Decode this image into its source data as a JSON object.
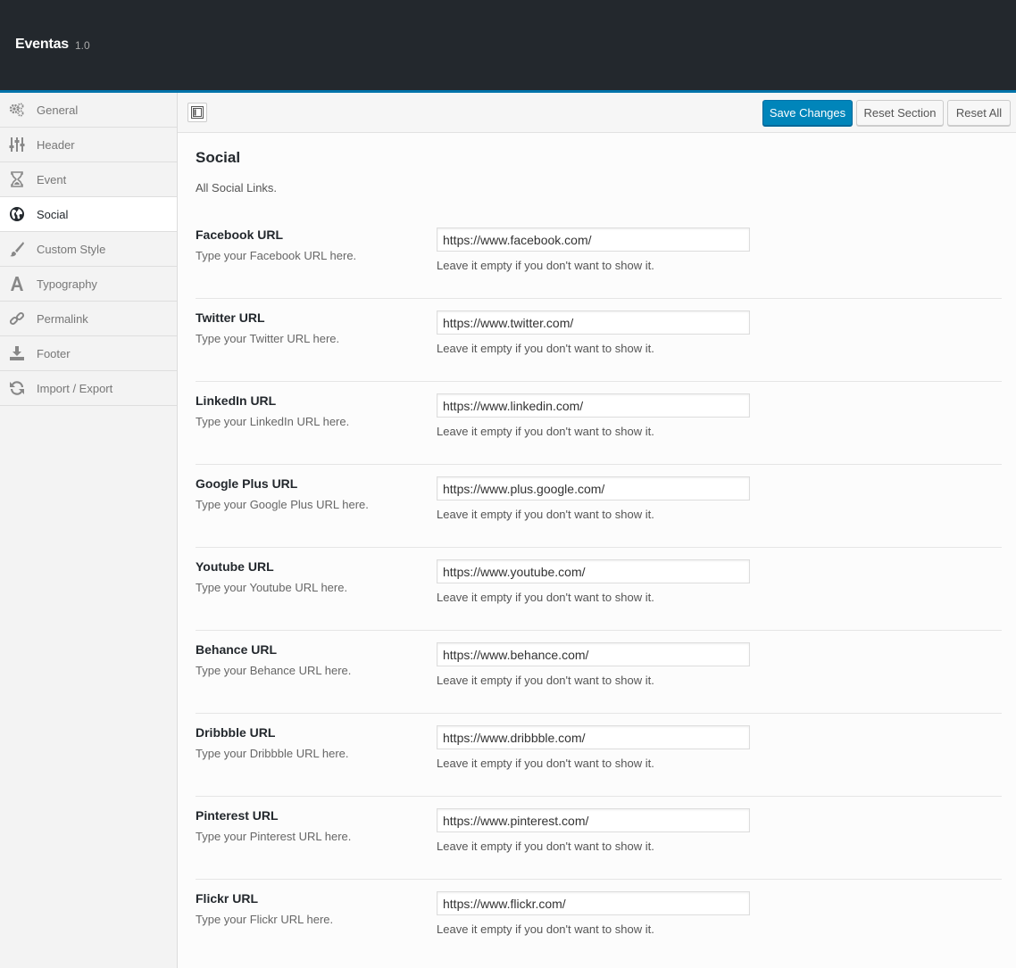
{
  "app": {
    "title": "Eventas",
    "version": "1.0"
  },
  "colors": {
    "header_bg": "#23282d",
    "accent": "#0073aa",
    "primary_button": "#0085ba"
  },
  "sidebar": {
    "items": [
      {
        "label": "General",
        "icon": "gears-icon",
        "active": false
      },
      {
        "label": "Header",
        "icon": "sliders-icon",
        "active": false
      },
      {
        "label": "Event",
        "icon": "hourglass-icon",
        "active": false
      },
      {
        "label": "Social",
        "icon": "globe-icon",
        "active": true
      },
      {
        "label": "Custom Style",
        "icon": "brush-icon",
        "active": false
      },
      {
        "label": "Typography",
        "icon": "font-icon",
        "active": false
      },
      {
        "label": "Permalink",
        "icon": "link-icon",
        "active": false
      },
      {
        "label": "Footer",
        "icon": "download-icon",
        "active": false
      },
      {
        "label": "Import / Export",
        "icon": "refresh-icon",
        "active": false
      }
    ]
  },
  "toolbar": {
    "layout_toggle_icon": "layout-icon",
    "save_label": "Save Changes",
    "reset_section_label": "Reset Section",
    "reset_all_label": "Reset All"
  },
  "section": {
    "title": "Social",
    "description": "All Social Links.",
    "fields": [
      {
        "title": "Facebook URL",
        "subtitle": "Type your Facebook URL here.",
        "value": "https://www.facebook.com/",
        "help": "Leave it empty if you don't want to show it."
      },
      {
        "title": "Twitter URL",
        "subtitle": "Type your Twitter URL here.",
        "value": "https://www.twitter.com/",
        "help": "Leave it empty if you don't want to show it."
      },
      {
        "title": "LinkedIn URL",
        "subtitle": "Type your LinkedIn URL here.",
        "value": "https://www.linkedin.com/",
        "help": "Leave it empty if you don't want to show it."
      },
      {
        "title": "Google Plus URL",
        "subtitle": "Type your Google Plus URL here.",
        "value": "https://www.plus.google.com/",
        "help": "Leave it empty if you don't want to show it."
      },
      {
        "title": "Youtube URL",
        "subtitle": "Type your Youtube URL here.",
        "value": "https://www.youtube.com/",
        "help": "Leave it empty if you don't want to show it."
      },
      {
        "title": "Behance URL",
        "subtitle": "Type your Behance URL here.",
        "value": "https://www.behance.com/",
        "help": "Leave it empty if you don't want to show it."
      },
      {
        "title": "Dribbble URL",
        "subtitle": "Type your Dribbble URL here.",
        "value": "https://www.dribbble.com/",
        "help": "Leave it empty if you don't want to show it."
      },
      {
        "title": "Pinterest URL",
        "subtitle": "Type your Pinterest URL here.",
        "value": "https://www.pinterest.com/",
        "help": "Leave it empty if you don't want to show it."
      },
      {
        "title": "Flickr URL",
        "subtitle": "Type your Flickr URL here.",
        "value": "https://www.flickr.com/",
        "help": "Leave it empty if you don't want to show it."
      }
    ]
  }
}
